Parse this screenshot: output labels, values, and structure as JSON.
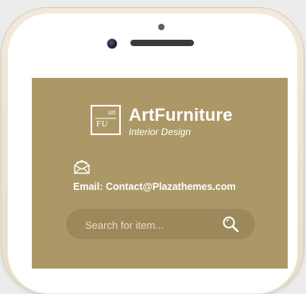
{
  "brand": {
    "logo_small": "art",
    "logo_big": "FU",
    "name": "ArtFurniture",
    "tagline": "Interior Design"
  },
  "contact": {
    "icon": "mail-icon",
    "email_text": "Email: Contact@Plazathemes.com"
  },
  "search": {
    "placeholder": "Search for item...",
    "value": "",
    "icon": "search-icon"
  },
  "colors": {
    "screen_background": "#ac9867",
    "search_background": "#9c885a",
    "text": "#ffffff"
  }
}
